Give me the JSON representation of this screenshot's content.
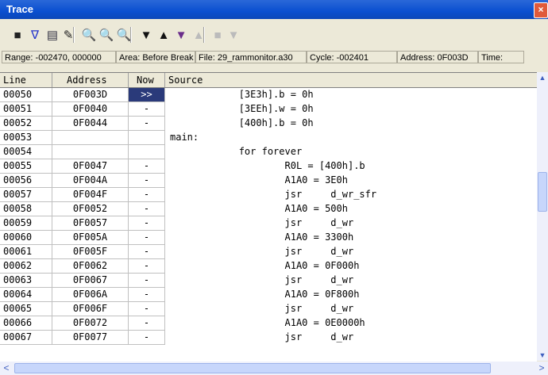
{
  "window": {
    "title": "Trace",
    "close": "×"
  },
  "toolbar": {
    "buttons": [
      {
        "name": "record-icon",
        "glyph": "■"
      },
      {
        "name": "filter-icon",
        "glyph": "∇"
      },
      {
        "name": "document-icon",
        "glyph": "▤"
      },
      {
        "name": "pencil-icon",
        "glyph": "✎"
      },
      {
        "name": "search-icon",
        "glyph": "🔍"
      },
      {
        "name": "search-prev-icon",
        "glyph": "🔍"
      },
      {
        "name": "search-next-icon",
        "glyph": "🔍"
      },
      {
        "name": "triangle-down-icon",
        "glyph": "▼"
      },
      {
        "name": "triangle-up-icon",
        "glyph": "▲"
      },
      {
        "name": "jump-down-icon",
        "glyph": "▼"
      },
      {
        "name": "jump-up-icon",
        "glyph": "▲"
      },
      {
        "name": "stop-icon",
        "glyph": "■"
      },
      {
        "name": "next-icon",
        "glyph": "▼"
      }
    ]
  },
  "infobar": {
    "range": "Range: -002470, 000000",
    "area": "Area: Before Break",
    "file": "File: 29_rammonitor.a30",
    "cycle": "Cycle: -002401",
    "address": "Address: 0F003D",
    "time": "Time:"
  },
  "table": {
    "headers": [
      "Line",
      "Address",
      "Now",
      "Source"
    ],
    "rows": [
      {
        "line": "00050",
        "addr": "0F003D",
        "now": ">>",
        "src": "            [3E3h].b = 0h"
      },
      {
        "line": "00051",
        "addr": "0F0040",
        "now": "-",
        "src": "            [3EEh].w = 0h"
      },
      {
        "line": "00052",
        "addr": "0F0044",
        "now": "-",
        "src": "            [400h].b = 0h"
      },
      {
        "line": "00053",
        "addr": "",
        "now": "",
        "src": "main:"
      },
      {
        "line": "00054",
        "addr": "",
        "now": "",
        "src": "            for forever"
      },
      {
        "line": "00055",
        "addr": "0F0047",
        "now": "-",
        "src": "                    R0L = [400h].b"
      },
      {
        "line": "00056",
        "addr": "0F004A",
        "now": "-",
        "src": "                    A1A0 = 3E0h"
      },
      {
        "line": "00057",
        "addr": "0F004F",
        "now": "-",
        "src": "                    jsr     d_wr_sfr"
      },
      {
        "line": "00058",
        "addr": "0F0052",
        "now": "-",
        "src": "                    A1A0 = 500h"
      },
      {
        "line": "00059",
        "addr": "0F0057",
        "now": "-",
        "src": "                    jsr     d_wr"
      },
      {
        "line": "00060",
        "addr": "0F005A",
        "now": "-",
        "src": "                    A1A0 = 3300h"
      },
      {
        "line": "00061",
        "addr": "0F005F",
        "now": "-",
        "src": "                    jsr     d_wr"
      },
      {
        "line": "00062",
        "addr": "0F0062",
        "now": "-",
        "src": "                    A1A0 = 0F000h"
      },
      {
        "line": "00063",
        "addr": "0F0067",
        "now": "-",
        "src": "                    jsr     d_wr"
      },
      {
        "line": "00064",
        "addr": "0F006A",
        "now": "-",
        "src": "                    A1A0 = 0F800h"
      },
      {
        "line": "00065",
        "addr": "0F006F",
        "now": "-",
        "src": "                    jsr     d_wr"
      },
      {
        "line": "00066",
        "addr": "0F0072",
        "now": "-",
        "src": "                    A1A0 = 0E0000h"
      },
      {
        "line": "00067",
        "addr": "0F0077",
        "now": "-",
        "src": "                    jsr     d_wr"
      }
    ]
  },
  "scroll": {
    "up": "▲",
    "down": "▼",
    "left": "<",
    "right": ">"
  },
  "colors": {
    "titlebar": "#0a4fd0",
    "active_row": "#2a3a7a"
  }
}
